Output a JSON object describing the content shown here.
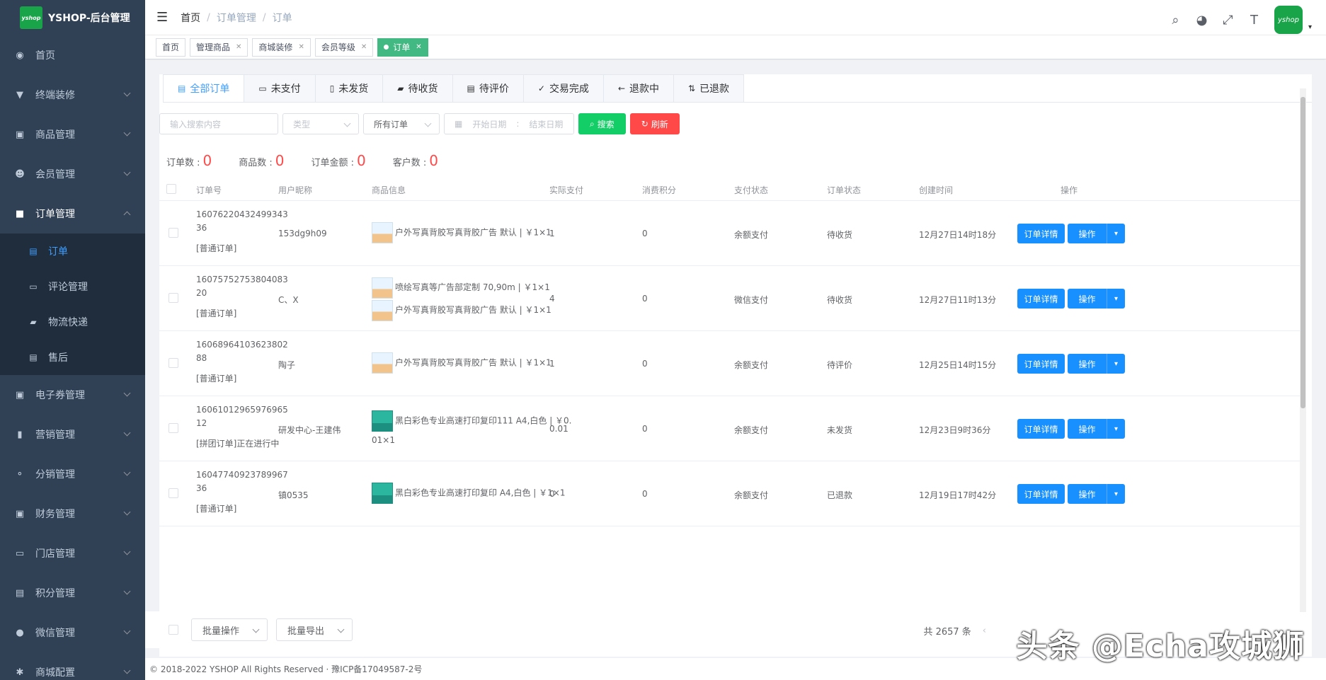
{
  "app": {
    "title": "YSHOP-后台管理",
    "logo_text": "yshop"
  },
  "sidebar": {
    "items": [
      {
        "label": "首页",
        "icon": "dashboard-icon"
      },
      {
        "label": "终端装修",
        "icon": "shirt-icon"
      },
      {
        "label": "商品管理",
        "icon": "goods-icon"
      },
      {
        "label": "会员管理",
        "icon": "user-group-icon"
      },
      {
        "label": "订单管理",
        "icon": "lock-icon"
      },
      {
        "label": "电子券管理",
        "icon": "coupon-icon"
      },
      {
        "label": "营销管理",
        "icon": "chart-icon"
      },
      {
        "label": "分销管理",
        "icon": "share-icon"
      },
      {
        "label": "财务管理",
        "icon": "finance-icon"
      },
      {
        "label": "门店管理",
        "icon": "store-icon"
      },
      {
        "label": "积分管理",
        "icon": "points-icon"
      },
      {
        "label": "微信管理",
        "icon": "wechat-icon"
      },
      {
        "label": "商城配置",
        "icon": "settings-icon"
      }
    ],
    "subitems": [
      {
        "label": "订单",
        "icon": "order-icon"
      },
      {
        "label": "评论管理",
        "icon": "comment-icon"
      },
      {
        "label": "物流快递",
        "icon": "truck-icon"
      },
      {
        "label": "售后",
        "icon": "service-icon"
      }
    ]
  },
  "breadcrumb": [
    "首页",
    "订单管理",
    "订单"
  ],
  "tags": [
    {
      "label": "首页",
      "closable": false
    },
    {
      "label": "管理商品",
      "closable": true
    },
    {
      "label": "商城装修",
      "closable": true
    },
    {
      "label": "会员等级",
      "closable": true
    },
    {
      "label": "订单",
      "closable": true,
      "active": true
    }
  ],
  "order_tabs": [
    "全部订单",
    "未支付",
    "未发货",
    "待收货",
    "待评价",
    "交易完成",
    "退款中",
    "已退款"
  ],
  "filters": {
    "search_placeholder": "输入搜索内容",
    "type_placeholder": "类型",
    "order_select": "所有订单",
    "start_date": "开始日期",
    "date_sep": ":",
    "end_date": "结束日期",
    "search_btn": "搜索",
    "refresh_btn": "刷新"
  },
  "stats": [
    {
      "label": "订单数 :",
      "value": "0"
    },
    {
      "label": "商品数 :",
      "value": "0"
    },
    {
      "label": "订单金额 :",
      "value": "0"
    },
    {
      "label": "客户数 :",
      "value": "0"
    }
  ],
  "table": {
    "headers": [
      "订单号",
      "用户昵称",
      "商品信息",
      "实际支付",
      "消费积分",
      "支付状态",
      "订单状态",
      "创建时间",
      "操作"
    ],
    "rows": [
      {
        "order_no_1": "16076220432499343",
        "order_no_2": "36",
        "type": "[普通订单]",
        "user": "153dg9h09",
        "goods": [
          {
            "text": "户外写真背胶写真背胶广告  默认 | ￥1×1"
          }
        ],
        "pay": "1",
        "points": "0",
        "pay_status": "余额支付",
        "status": "待收货",
        "time": "12月27日14时18分"
      },
      {
        "order_no_1": "16075752753804083",
        "order_no_2": "20",
        "type": "[普通订单]",
        "user": "C、X",
        "goods": [
          {
            "text": "喷绘写真等广告部定制  70,90m | ￥1×1"
          },
          {
            "text": "户外写真背胶写真背胶广告  默认 | ￥1×1"
          }
        ],
        "pay": "4",
        "points": "0",
        "pay_status": "微信支付",
        "status": "待收货",
        "time": "12月27日11时13分"
      },
      {
        "order_no_1": "16068964103623802",
        "order_no_2": "88",
        "type": "[普通订单]",
        "user": "陶子",
        "goods": [
          {
            "text": "户外写真背胶写真背胶广告  默认 | ￥1×1"
          }
        ],
        "pay": "1",
        "points": "0",
        "pay_status": "余额支付",
        "status": "待评价",
        "time": "12月25日14时15分"
      },
      {
        "order_no_1": "16061012965976965",
        "order_no_2": "12",
        "type": "[拼团订单]正在进行中",
        "user": "研发中心-王建伟",
        "goods": [
          {
            "text": "黑白彩色专业高速打印复印111  A4,白色 | ￥0.",
            "text2": "01×1"
          }
        ],
        "pay": "0.01",
        "points": "0",
        "pay_status": "余额支付",
        "status": "未发货",
        "time": "12月23日9时36分"
      },
      {
        "order_no_1": "16047740923789967",
        "order_no_2": "36",
        "type": "[普通订单]",
        "user": "镇0535",
        "goods": [
          {
            "text": "黑白彩色专业高速打印复印  A4,白色 | ￥1×1"
          }
        ],
        "pay": "0",
        "points": "0",
        "pay_status": "余额支付",
        "status": "已退款",
        "time": "12月19日17时42分"
      }
    ],
    "detail_btn": "订单详情",
    "op_btn": "操作"
  },
  "bottom": {
    "batch_op": "批量操作",
    "batch_export": "批量导出",
    "total": "共 2657 条"
  },
  "footer": "© 2018-2022 YSHOP All Rights Reserved · 豫ICP备17049587-2号",
  "watermark": "头条 @Echa攻城狮"
}
